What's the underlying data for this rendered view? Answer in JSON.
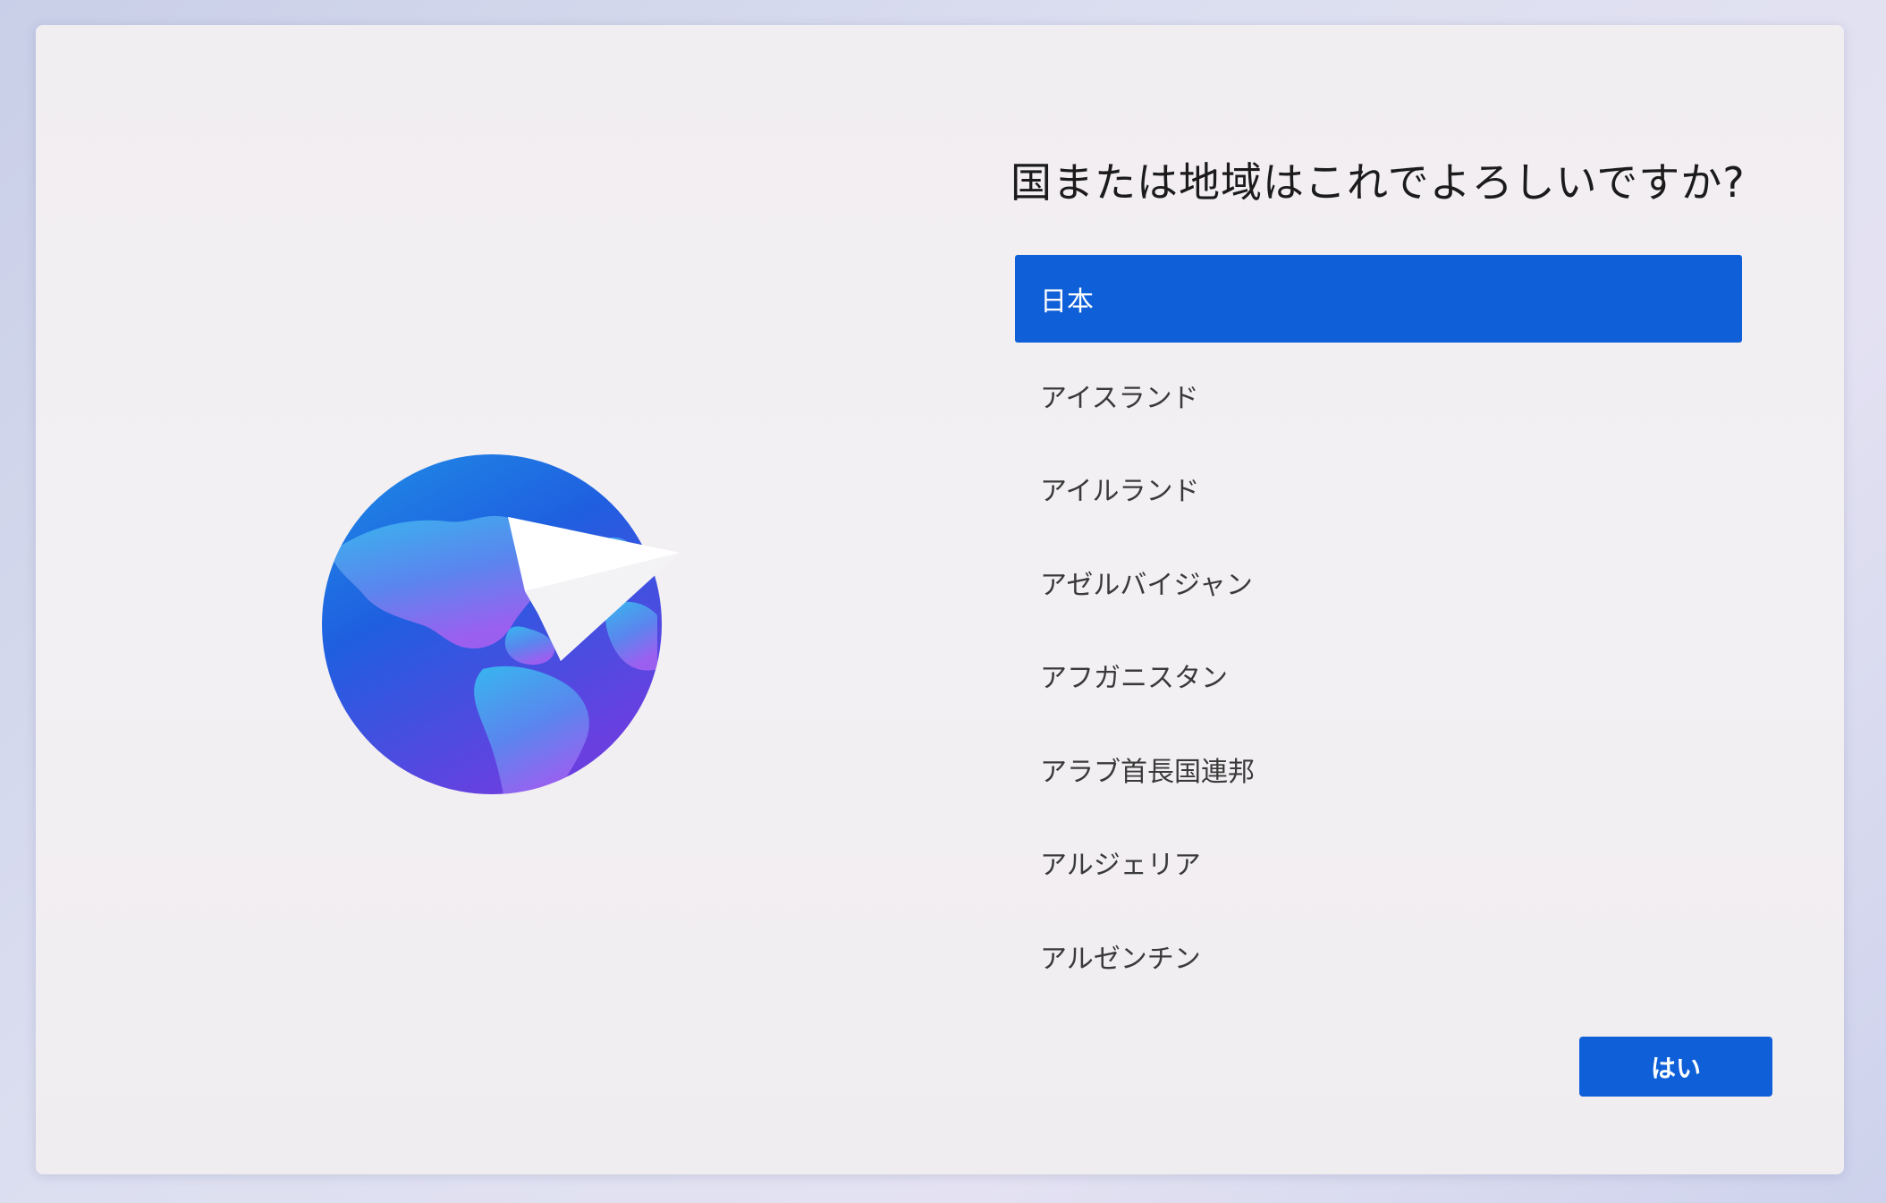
{
  "dialog": {
    "question": "国または地域はこれでよろしいですか?",
    "illustration_icon": "globe-with-paper-plane-icon"
  },
  "country_list": {
    "selected_index": 0,
    "items": [
      {
        "label": "日本",
        "selected": true
      },
      {
        "label": "アイスランド",
        "selected": false
      },
      {
        "label": "アイルランド",
        "selected": false
      },
      {
        "label": "アゼルバイジャン",
        "selected": false
      },
      {
        "label": "アフガニスタン",
        "selected": false
      },
      {
        "label": "アラブ首長国連邦",
        "selected": false
      },
      {
        "label": "アルジェリア",
        "selected": false
      },
      {
        "label": "アルゼンチン",
        "selected": false
      }
    ]
  },
  "actions": {
    "yes_label": "はい"
  },
  "colors": {
    "accent": "#0f5fd8",
    "dialog_background": "#f2eff2",
    "text_primary": "#1b1b1b",
    "text_secondary": "#3a3a3a"
  }
}
